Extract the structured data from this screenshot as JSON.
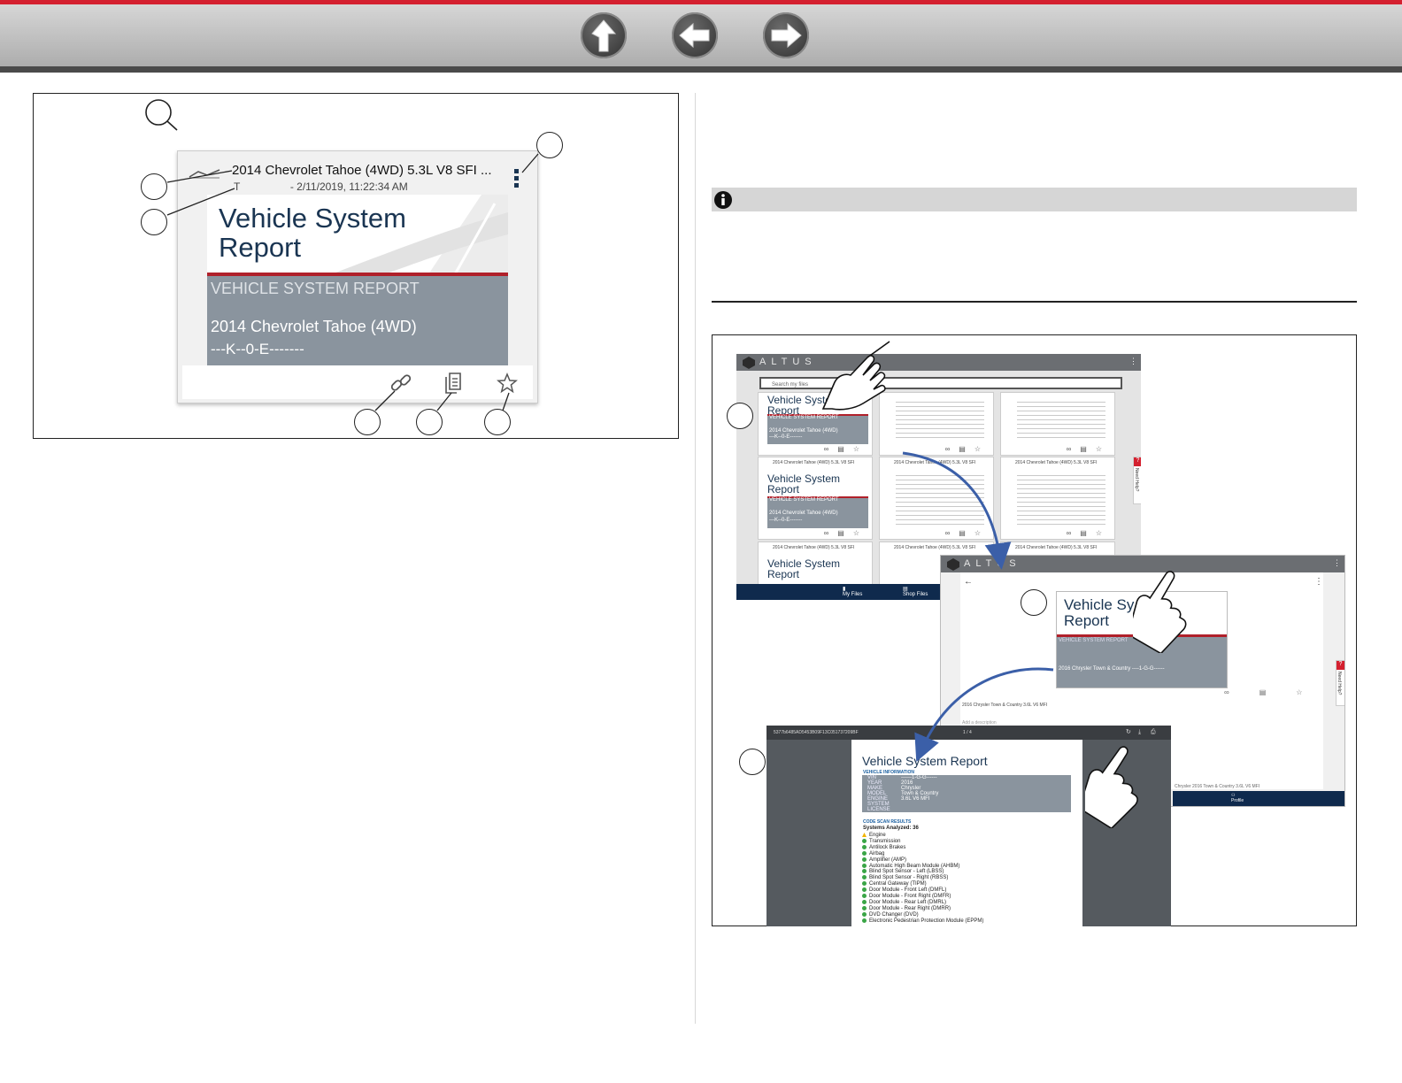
{
  "nav": {
    "up_icon": "up-arrow-icon",
    "back_icon": "left-arrow-icon",
    "forward_icon": "right-arrow-icon"
  },
  "file_card": {
    "title": "2014 Chevrolet Tahoe (4WD) 5.3L V8 SFI ...",
    "subtitle_prefix": "T",
    "subtitle_date": "- 2/11/2019, 11:22:34 AM",
    "thumb_heading_1": "Vehicle System",
    "thumb_heading_2": "Report",
    "thumb_band_label": "VEHICLE SYSTEM REPORT",
    "thumb_vehicle": "2014  Chevrolet  Tahoe (4WD)",
    "thumb_vin": "---K--0-E-------",
    "icons": [
      "link-icon",
      "document-icon",
      "star-icon",
      "more-vert-icon",
      "search-icon"
    ]
  },
  "screens": {
    "app_name": "ALTUS",
    "search_placeholder": "Search my files",
    "need_help": "Need Help?",
    "mini_heading_1": "Vehicle System",
    "mini_heading_2": "Report",
    "mini_band": "VEHICLE SYSTEM REPORT",
    "mini_vehicle": "2014  Chevrolet  Tahoe (4WD)",
    "mini_vin": "---K--0-E-------",
    "mini_caption": "2014 Chevrolet Tahoe (4WD) 5.3L V8 SFI",
    "footer_my_files": "My Files",
    "footer_shop_files": "Shop Files",
    "ss2_heading_1": "Vehicle Sy",
    "ss2_heading_2": "Report",
    "ss2_band": "VEHICLE SYSTEM REPORT",
    "ss2_vehicle": "2016  Chrysler  Town & Country  ----1-G-G------",
    "ss2_caption": "2016 Chrysler Town & Country 3.6L V6 MFI",
    "ss2_add_desc": "Add a description",
    "ss2_meta": "Chrysler    2016    Town & Country    3.6L V6 MFI",
    "ss2_footer_profile": "Profile",
    "pdf_id": "5377b6485AD5453B09F13C051737209BF",
    "pdf_pages": "1 / 4",
    "pdf_title": "Vehicle System Report",
    "vehicle_info_label": "VEHICLE INFORMATION",
    "vehicle_info": [
      {
        "k": "VIN",
        "v": "------1-G-G------"
      },
      {
        "k": "YEAR",
        "v": "2016"
      },
      {
        "k": "MAKE",
        "v": "Chrysler"
      },
      {
        "k": "MODEL",
        "v": "Town & Country"
      },
      {
        "k": "ENGINE",
        "v": "3.6L V6 MFI"
      },
      {
        "k": "SYSTEM",
        "v": ""
      },
      {
        "k": "LICENSE",
        "v": ""
      }
    ],
    "code_scan_label": "CODE SCAN RESULTS",
    "systems_analyzed": "Systems Analyzed: 36",
    "systems": [
      {
        "name": "Engine",
        "status": "warn"
      },
      {
        "name": "Transmission",
        "status": "ok"
      },
      {
        "name": "Antilock Brakes",
        "status": "ok"
      },
      {
        "name": "Airbag",
        "status": "ok"
      },
      {
        "name": "Amplifier (AMP)",
        "status": "ok"
      },
      {
        "name": "Automatic High Beam Module (AHBM)",
        "status": "ok"
      },
      {
        "name": "Blind Spot Sensor - Left (LBSS)",
        "status": "ok"
      },
      {
        "name": "Blind Spot Sensor - Right (RBSS)",
        "status": "ok"
      },
      {
        "name": "Central Gateway (TIPM)",
        "status": "ok"
      },
      {
        "name": "Door Module - Front Left (DMFL)",
        "status": "ok"
      },
      {
        "name": "Door Module - Front Right (DMFR)",
        "status": "ok"
      },
      {
        "name": "Door Module - Rear Left (DMRL)",
        "status": "ok"
      },
      {
        "name": "Door Module - Rear Right (DMRR)",
        "status": "ok"
      },
      {
        "name": "DVD Changer (DVD)",
        "status": "ok"
      },
      {
        "name": "Electronic Pedestrian Protection Module (EPPM)",
        "status": "ok"
      }
    ]
  },
  "colors": {
    "accent_red": "#d4202f",
    "navy": "#0f2a4d",
    "report_blue": "#1a3552",
    "band_gray": "#8a949e"
  }
}
